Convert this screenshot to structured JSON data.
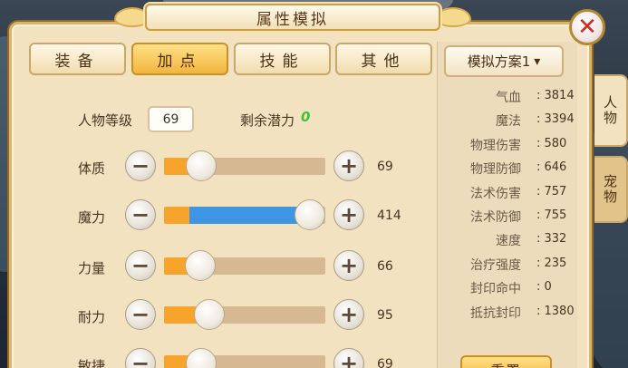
{
  "title": "属性模拟",
  "close_label": "✕",
  "tabs": [
    "装备",
    "加点",
    "技能",
    "其他"
  ],
  "active_tab": "加点",
  "level": {
    "label": "人物等级",
    "value": "69"
  },
  "potential": {
    "label": "剩余潜力",
    "value": "0"
  },
  "stats": [
    {
      "label": "体质",
      "value": "69",
      "fill": 0.17
    },
    {
      "label": "魔力",
      "value": "414",
      "fill": 1.0
    },
    {
      "label": "力量",
      "value": "66",
      "fill": 0.16
    },
    {
      "label": "耐力",
      "value": "95",
      "fill": 0.23
    },
    {
      "label": "敏捷",
      "value": "69",
      "fill": 0.17
    }
  ],
  "minus_label": "−",
  "plus_label": "+",
  "plan_select": {
    "label": "模拟方案1",
    "chevron": "▾"
  },
  "attributes": [
    {
      "name": "气血",
      "value": "3814"
    },
    {
      "name": "魔法",
      "value": "3394"
    },
    {
      "name": "物理伤害",
      "value": "580"
    },
    {
      "name": "物理防御",
      "value": "646"
    },
    {
      "name": "法术伤害",
      "value": "757"
    },
    {
      "name": "法术防御",
      "value": "755"
    },
    {
      "name": "速度",
      "value": "332"
    },
    {
      "name": "治疗强度",
      "value": "235"
    },
    {
      "name": "封印命中",
      "value": "0"
    },
    {
      "name": "抵抗封印",
      "value": "1380"
    }
  ],
  "attr_separator": ":",
  "reset_label": "重置",
  "side_tabs": [
    "人物",
    "宠物"
  ],
  "colors": {
    "panel_bg": "#f3e2c0",
    "active_tab": "#f2b53c",
    "track_bg": "#d6b992",
    "fill_orange": "#f6a42c",
    "fill_blue": "#3d95e4",
    "potential_green": "#3bc23b",
    "close_red": "#d42a1e"
  }
}
